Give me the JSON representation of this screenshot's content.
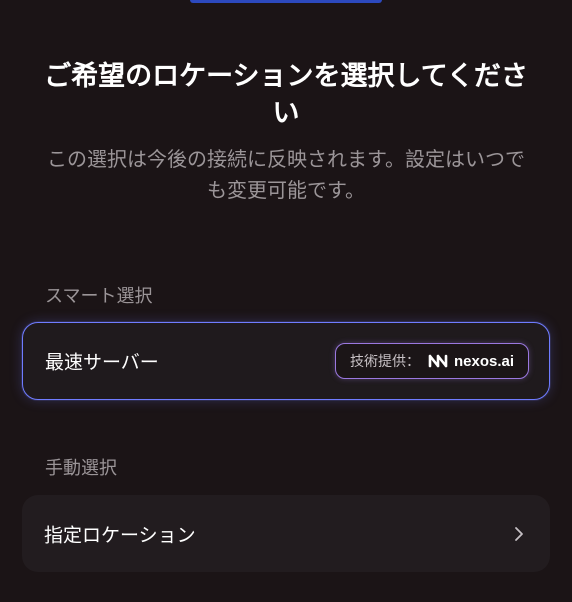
{
  "header": {
    "title": "ご希望のロケーションを選択してください",
    "subtitle": "この選択は今後の接続に反映されます。設定はいつでも変更可能です。"
  },
  "smart_section": {
    "label": "スマート選択",
    "fastest_server": {
      "label": "最速サーバー",
      "provider_prefix": "技術提供：",
      "provider_icon": "nexos-logo-icon",
      "provider_name": "nexos.ai"
    }
  },
  "manual_section": {
    "label": "手動選択",
    "location_item": {
      "label": "指定ロケーション",
      "icon": "chevron-right-icon"
    }
  },
  "colors": {
    "background": "#1b1416",
    "card": "#1f1a1d",
    "selected_border": "#6f7cff",
    "badge_border": "#9b78e0",
    "muted_text": "#9b9598"
  }
}
